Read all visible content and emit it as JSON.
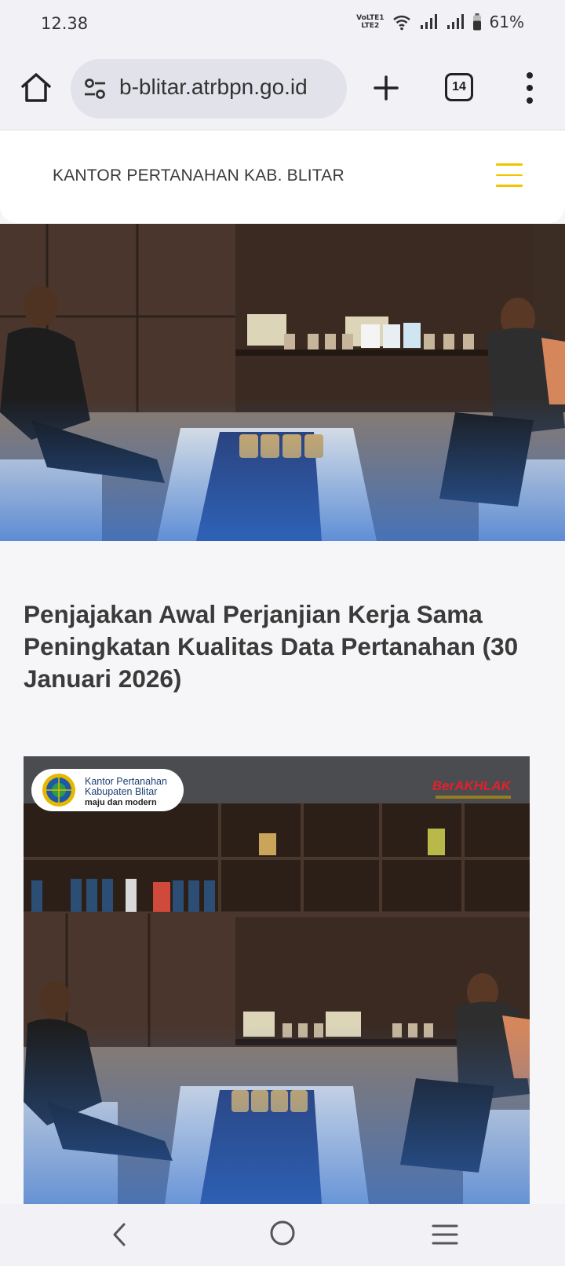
{
  "status_bar": {
    "time": "12.38",
    "network_label_top": "VoLTE1",
    "network_label_bottom": "LTE2",
    "battery": "61%"
  },
  "browser": {
    "url": "b-blitar.atrbpn.go.id",
    "tab_count": "14"
  },
  "site": {
    "title": "KANTOR PERTANAHAN KAB. BLITAR"
  },
  "article": {
    "title": "Penjajakan Awal Perjanjian Kerja Sama Peningkatan Kualitas Data Pertanahan (30 Januari 2026)",
    "image_logo": {
      "line1": "Kantor Pertanahan",
      "line2": "Kabupaten Blitar",
      "line3": "maju dan modern"
    },
    "image_badge": "BerAKHLAK"
  },
  "colors": {
    "accent": "#f2c400",
    "browser_bg": "#f1f1f6",
    "page_bg": "#f6f6f8"
  }
}
